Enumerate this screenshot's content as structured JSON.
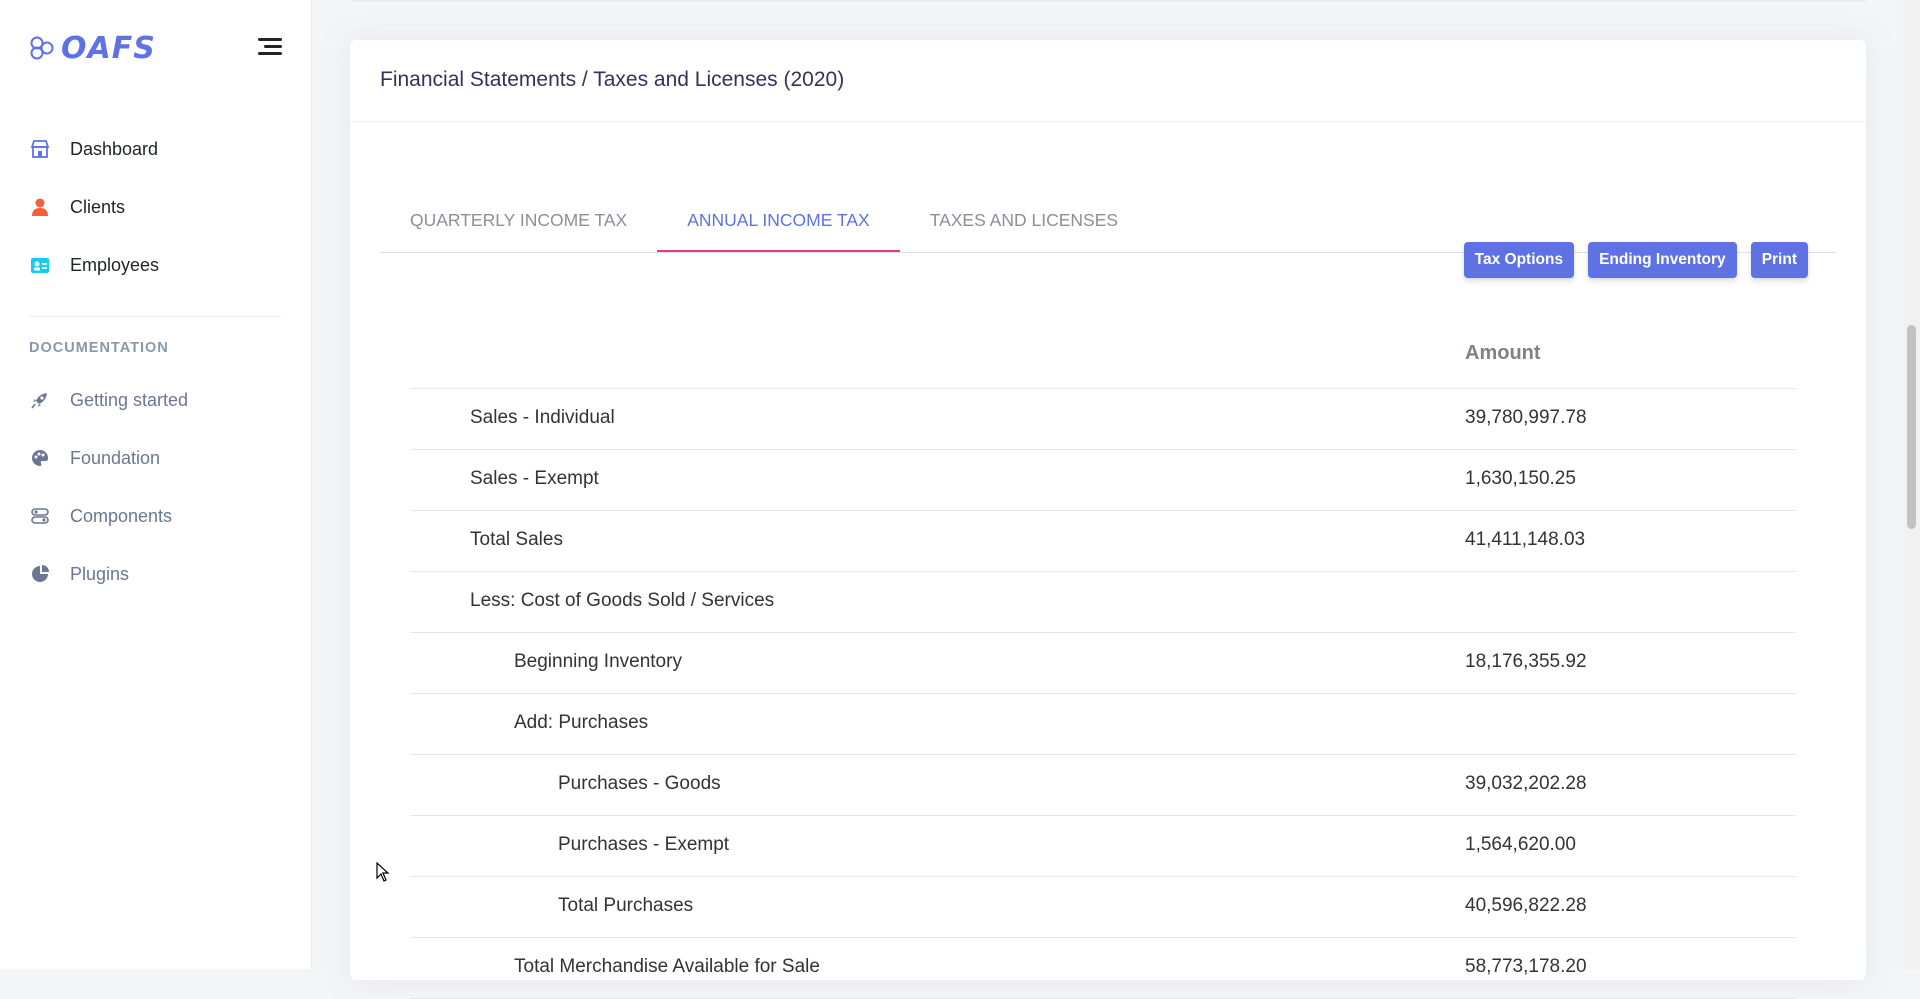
{
  "brand": {
    "name": "OAFS"
  },
  "sidebar": {
    "primary": [
      {
        "label": "Dashboard",
        "icon": "store-icon"
      },
      {
        "label": "Clients",
        "icon": "user-icon"
      },
      {
        "label": "Employees",
        "icon": "id-badge-icon"
      }
    ],
    "docs_heading": "DOCUMENTATION",
    "docs": [
      {
        "label": "Getting started",
        "icon": "rocket-icon"
      },
      {
        "label": "Foundation",
        "icon": "palette-icon"
      },
      {
        "label": "Components",
        "icon": "components-icon"
      },
      {
        "label": "Plugins",
        "icon": "pie-chart-icon"
      }
    ]
  },
  "card": {
    "title": "Financial Statements / Taxes and Licenses (2020)",
    "tabs": [
      {
        "label": "QUARTERLY INCOME TAX",
        "active": false
      },
      {
        "label": "ANNUAL INCOME TAX",
        "active": true
      },
      {
        "label": "TAXES AND LICENSES",
        "active": false
      }
    ],
    "buttons": {
      "tax_options": "Tax Options",
      "ending_inventory": "Ending Inventory",
      "print": "Print"
    },
    "table": {
      "amount_header": "Amount",
      "rows": [
        {
          "label": "Sales - Individual",
          "amount": "39,780,997.78",
          "level": 0
        },
        {
          "label": "Sales - Exempt",
          "amount": "1,630,150.25",
          "level": 0
        },
        {
          "label": "Total Sales",
          "amount": "41,411,148.03",
          "level": 0
        },
        {
          "label": "Less: Cost of Goods Sold / Services",
          "amount": "",
          "level": 0
        },
        {
          "label": "Beginning Inventory",
          "amount": "18,176,355.92",
          "level": 1
        },
        {
          "label": "Add: Purchases",
          "amount": "",
          "level": 1
        },
        {
          "label": "Purchases - Goods",
          "amount": "39,032,202.28",
          "level": 2
        },
        {
          "label": "Purchases - Exempt",
          "amount": "1,564,620.00",
          "level": 2
        },
        {
          "label": "Total Purchases",
          "amount": "40,596,822.28",
          "level": 2
        },
        {
          "label": "Total Merchandise Available for Sale",
          "amount": "58,773,178.20",
          "level": 1
        }
      ]
    }
  },
  "colors": {
    "primary": "#5e72e4",
    "tab_underline": "#f3367f",
    "client_icon": "#f5603c",
    "employee_icon": "#11cdef"
  }
}
